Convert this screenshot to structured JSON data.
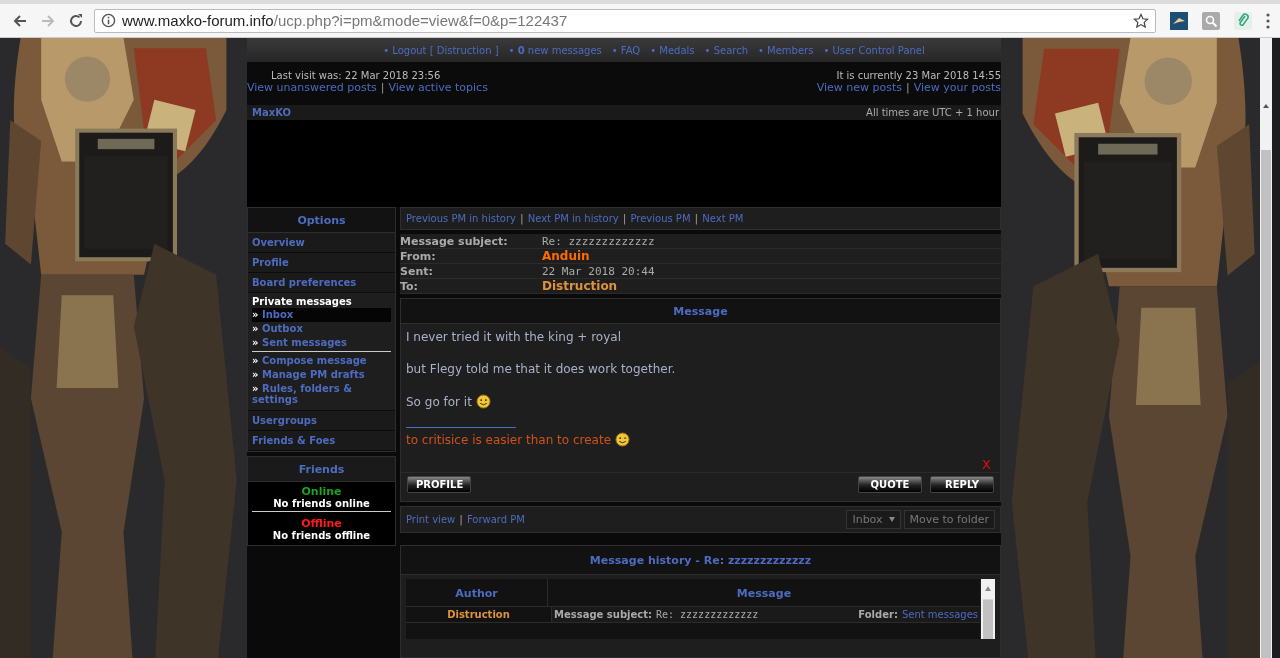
{
  "browser": {
    "url_host": "www.maxko-forum.info",
    "url_path": "/ucp.php?i=pm&mode=view&f=0&p=122437"
  },
  "nav_links": [
    "• Logout [ Distruction ]",
    "• **0** new messages",
    "• FAQ",
    "• Medals",
    "• Search",
    "• Members",
    "• User Control Panel"
  ],
  "info": {
    "last_visit": "Last visit was: 22 Mar 2018 23:56",
    "current_time": "It is currently 23 Mar 2018 14:55",
    "separator": "|",
    "left_links": [
      "View unanswered posts",
      "View active topics"
    ],
    "right_links": [
      "View new posts",
      "View your posts"
    ]
  },
  "breadcrumb": {
    "home": "MaxKO",
    "timezone": "All times are UTC + 1 hour"
  },
  "sidebar": {
    "title": "Options",
    "items": [
      "Overview",
      "Profile",
      "Board preferences"
    ],
    "pm_title": "Private messages",
    "marker": "»",
    "pm_folders": [
      {
        "label": "Inbox",
        "selected": true
      },
      {
        "label": "Outbox",
        "selected": false
      },
      {
        "label": "Sent messages",
        "selected": false
      }
    ],
    "pm_actions": [
      "Compose message",
      "Manage PM drafts",
      "Rules, folders & settings"
    ],
    "more_items": [
      "Usergroups",
      "Friends & Foes"
    ]
  },
  "friends": {
    "title": "Friends",
    "groups": [
      {
        "label": "Online",
        "color": "#1fa01f",
        "text": "No friends online"
      },
      {
        "label": "Offline",
        "color": "#ff1a1a",
        "text": "No friends offline"
      }
    ]
  },
  "pm_nav": {
    "separator": "|",
    "links": [
      "Previous PM in history",
      "Next PM in history",
      "Previous PM",
      "Next PM"
    ]
  },
  "headers": [
    {
      "label": "Message subject:",
      "value": "Re: zzzzzzzzzzzzz"
    },
    {
      "label": "From:",
      "value": "Anduin",
      "color": "#ff6a00"
    },
    {
      "label": "Sent:",
      "value": "22 Mar 2018 20:44"
    },
    {
      "label": "To:",
      "value": "Distruction",
      "color": "#e0913c"
    }
  ],
  "message": {
    "title": "Message",
    "paragraphs": [
      {
        "text": "I never tried it with the king + royal",
        "smiley": false
      },
      {
        "text": "but Flegy told me that it does work together.",
        "smiley": false
      },
      {
        "text": "So go for it",
        "smiley": true
      }
    ],
    "signature": {
      "text": "to critisice is easier than to create",
      "smiley": true
    },
    "delete": "X",
    "buttons_left": [
      "PROFILE"
    ],
    "buttons_right": [
      "QUOTE",
      "REPLY"
    ]
  },
  "actions": {
    "separator": "|",
    "links": [
      "Print view",
      "Forward PM"
    ],
    "folder": "Inbox",
    "move": "Move to folder"
  },
  "history": {
    "title": "Message history - Re: zzzzzzzzzzzzz",
    "columns": [
      "Author",
      "Message"
    ],
    "rows": [
      {
        "author": "Distruction",
        "subject_label": "Message subject:",
        "subject": "Re: zzzzzzzzzzzzz",
        "folder_label": "Folder:",
        "folder": "Sent messages"
      }
    ]
  }
}
